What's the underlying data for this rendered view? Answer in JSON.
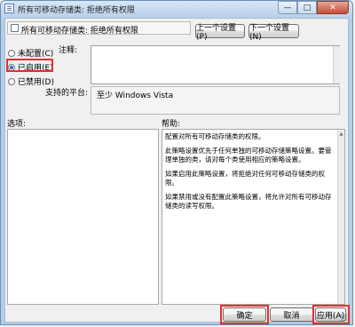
{
  "window": {
    "title": "所有可移动存储类: 拒绝所有权限",
    "minimize_glyph": "—",
    "maximize_glyph": "□",
    "close_glyph": "✕"
  },
  "policy_name": "所有可移动存储类: 拒绝所有权限",
  "nav": {
    "prev_label": "上一个设置(P)",
    "next_label": "下一个设置(N)"
  },
  "state_options": [
    {
      "label": "未配置(C)",
      "selected": false
    },
    {
      "label": "已启用(E)",
      "selected": true
    },
    {
      "label": "已禁用(D)",
      "selected": false
    }
  ],
  "comment": {
    "label": "注释:",
    "value": ""
  },
  "supported": {
    "label": "支持的平台:",
    "value": "至少 Windows Vista"
  },
  "options_label": "选项:",
  "help_label": "帮助:",
  "help_paragraphs": [
    "配置对所有可移动存储类的权限。",
    "此策略设置优先于任何单独的可移动存储策略设置。要管理单独的类，请对每个类使用相应的策略设置。",
    "如果启用此策略设置，将拒绝对任何可移动存储类的权限。",
    "如果禁用或没有配置此策略设置，将允许对所有可移动存储类的读写权限。"
  ],
  "footer": {
    "ok_label": "确定",
    "cancel_label": "取消",
    "apply_label": "应用(A)"
  },
  "colors": {
    "highlight": "#e23030",
    "title_bar": "#b9d1ea"
  }
}
